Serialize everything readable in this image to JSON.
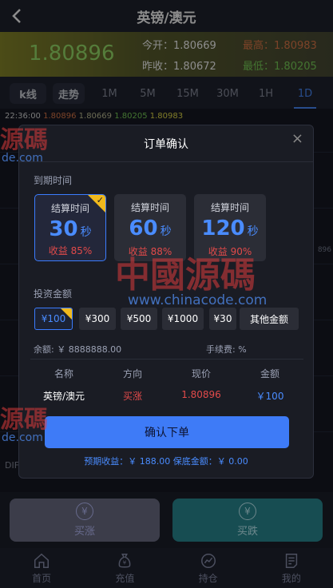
{
  "header": {
    "title": "英镑/澳元"
  },
  "price": {
    "current": "1.80896",
    "open_label": "今开：",
    "open": "1.80669",
    "prev_label": "昨收：",
    "prev": "1.80672",
    "high_label": "最高：",
    "high": "1.80983",
    "low_label": "最低：",
    "low": "1.80205"
  },
  "tabs": [
    "k线",
    "走势",
    "1M",
    "5M",
    "15M",
    "30M",
    "1H",
    "1D"
  ],
  "chart_info": {
    "time": "22:36:00",
    "a": "1.80896",
    "b": "1.80669",
    "c": "1.80205",
    "d": "1.80983"
  },
  "side_tick": "896",
  "dif_label": "DIF",
  "trade": {
    "buy": "买涨",
    "sell": "买跌",
    "coin_symbol": "¥"
  },
  "nav": [
    {
      "label": "首页",
      "icon": "home-icon"
    },
    {
      "label": "充值",
      "icon": "money-bag-icon"
    },
    {
      "label": "持仓",
      "icon": "chart-icon"
    },
    {
      "label": "我的",
      "icon": "document-icon"
    }
  ],
  "modal": {
    "title": "订单确认",
    "close": "×",
    "expiry_label": "到期时间",
    "cards": [
      {
        "title": "结算时间",
        "value": "30",
        "unit": "秒",
        "profit": "收益 85%"
      },
      {
        "title": "结算时间",
        "value": "60",
        "unit": "秒",
        "profit": "收益 88%"
      },
      {
        "title": "结算时间",
        "value": "120",
        "unit": "秒",
        "profit": "收益 90%"
      }
    ],
    "amount_label": "投资金额",
    "amounts": [
      "¥100",
      "¥300",
      "¥500",
      "¥1000",
      "¥30",
      "其他金额"
    ],
    "balance": "余额: ￥ 8888888.00",
    "fee": "手续费: %",
    "table_headers": [
      "名称",
      "方向",
      "现价",
      "金额"
    ],
    "table_row": [
      "英镑/澳元",
      "买涨",
      "1.80896",
      "￥100"
    ],
    "confirm": "确认下单",
    "expect": "预期收益：￥ 188.00    保底金额：￥ 0.00"
  },
  "watermark": {
    "text": "中國源碼",
    "url": "www.chinacode.com",
    "left_text": "源碼",
    "left_url": "de.com"
  },
  "colors": {
    "accent": "#3e7bf7",
    "rise": "#e24a4a",
    "badge": "#f0b91c"
  }
}
